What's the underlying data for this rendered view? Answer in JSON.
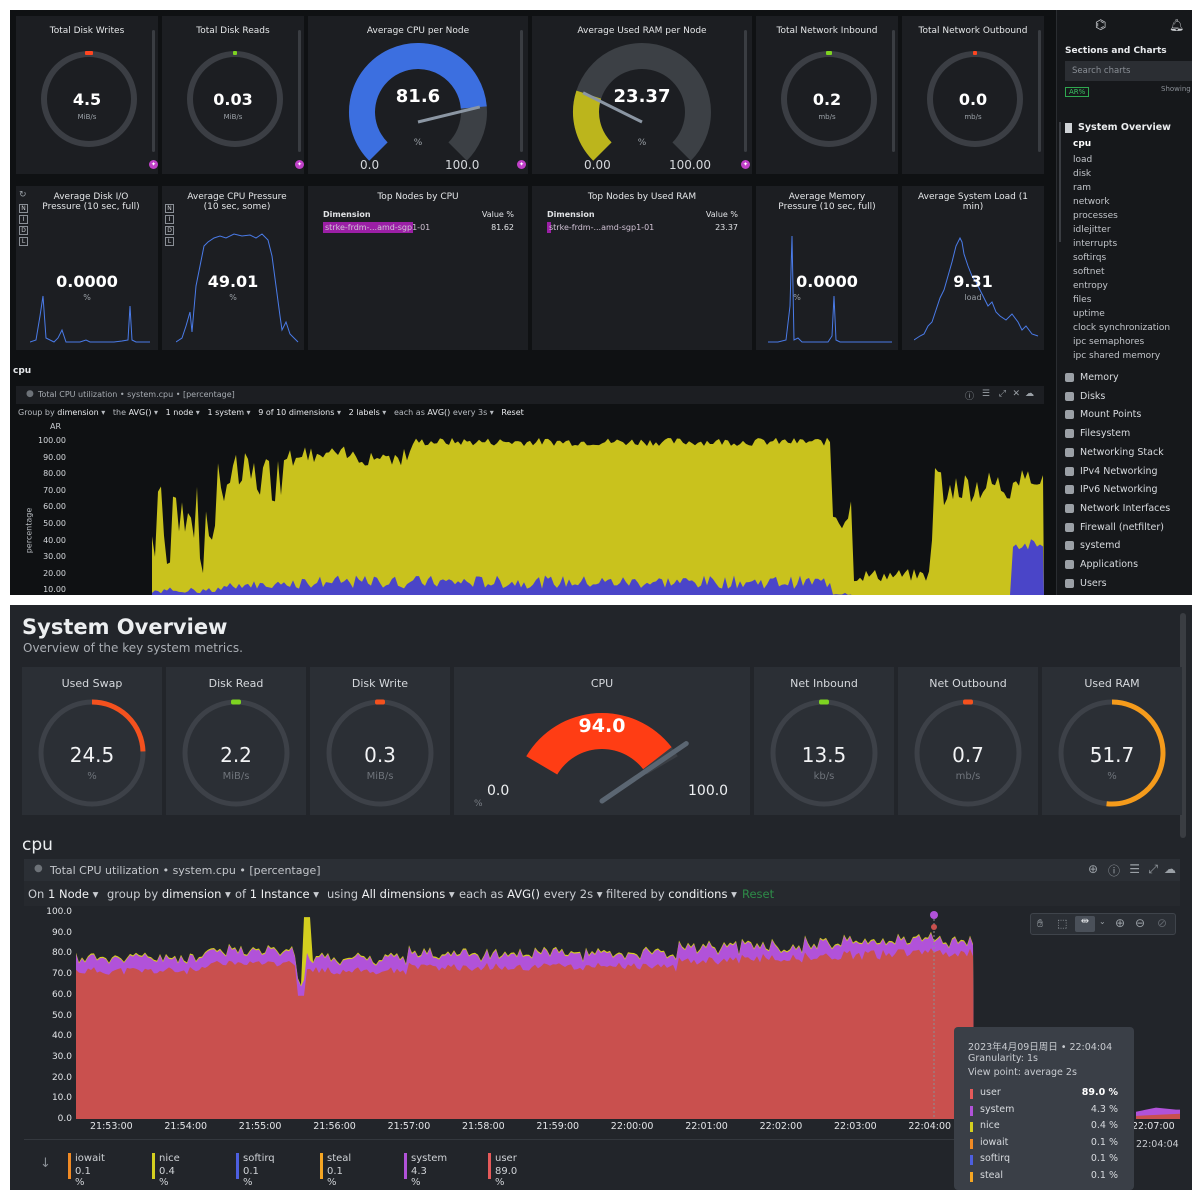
{
  "top": {
    "gauges": [
      {
        "title": "Total Disk Writes",
        "value": "4.5",
        "unit": "MiB/s",
        "marker_color": "#ff4520"
      },
      {
        "title": "Total Disk Reads",
        "value": "0.03",
        "unit": "MiB/s",
        "marker_color": "#7ed321"
      }
    ],
    "gauges_right": [
      {
        "title": "Total Network Inbound",
        "value": "0.2",
        "unit": "mb/s",
        "marker_color": "#7ed321"
      },
      {
        "title": "Total Network Outbound",
        "value": "0.0",
        "unit": "mb/s",
        "marker_color": "#ff4520"
      }
    ],
    "big_gauges": [
      {
        "title": "Average CPU per Node",
        "value": "81.6",
        "unit": "%",
        "min": "0.0",
        "max": "100.0",
        "fraction": 0.816,
        "color": "#3c6fe0"
      },
      {
        "title": "Average Used RAM per Node",
        "value": "23.37",
        "unit": "%",
        "min": "0.00",
        "max": "100.00",
        "fraction": 0.2337,
        "color": "#bcb51c"
      }
    ],
    "sparks": [
      {
        "title": "Average Disk I/O Pressure (10 sec, full)",
        "value": "0.0000",
        "unit": "%"
      },
      {
        "title": "Average CPU Pressure (10 sec, some)",
        "value": "49.01",
        "unit": "%"
      },
      {
        "title": "Average Memory Pressure (10 sec, full)",
        "value": "0.0000",
        "unit": "%"
      },
      {
        "title": "Average System Load (1 min)",
        "value": "9.31",
        "unit": "load"
      }
    ],
    "side_letters": [
      "N",
      "I",
      "D",
      "L"
    ],
    "top_nodes": [
      {
        "title": "Top Nodes by CPU",
        "col1": "Dimension",
        "col2": "Value %",
        "name": "strke-frdm-...amd-sgp1-01",
        "value": "81.62",
        "bar_fraction": 0.82
      },
      {
        "title": "Top Nodes by Used RAM",
        "col1": "Dimension",
        "col2": "Value %",
        "name": "strke-frdm-...amd-sgp1-01",
        "value": "23.37",
        "bar_fraction": 0.03
      }
    ],
    "section_label": "cpu",
    "chart_header": "Total CPU utilization • system.cpu • [percentage]",
    "chart_controls": {
      "group_by": "Group by",
      "group_by_val": "dimension",
      "the": "the",
      "the_val": "AVG()",
      "node": "1 node",
      "system": "1 system",
      "dims": "9 of 10 dimensions",
      "labels": "2 labels",
      "each_as": "each as",
      "each_as_val": "AVG()",
      "every": "every 3s",
      "reset": "Reset"
    },
    "chart_ylabel": "percentage",
    "chart_ar": "AR",
    "chart_yticks": [
      "100.00",
      "90.00",
      "80.00",
      "70.00",
      "60.00",
      "50.00",
      "40.00",
      "30.00",
      "20.00",
      "10.00"
    ],
    "sidebar": {
      "title": "Sections and Charts",
      "search_placeholder": "Search charts",
      "ar_badge": "AR%",
      "showing": "Showing",
      "active_section": "System Overview",
      "active_item": "cpu",
      "items": [
        "load",
        "disk",
        "ram",
        "network",
        "processes",
        "idlejitter",
        "interrupts",
        "softirqs",
        "softnet",
        "entropy",
        "files",
        "uptime",
        "clock synchronization",
        "ipc semaphores",
        "ipc shared memory"
      ],
      "groups": [
        "Memory",
        "Disks",
        "Mount Points",
        "Filesystem",
        "Networking Stack",
        "IPv4 Networking",
        "IPv6 Networking",
        "Network Interfaces",
        "Firewall (netfilter)",
        "systemd",
        "Applications",
        "Users"
      ]
    }
  },
  "bottom": {
    "title": "System Overview",
    "subtitle": "Overview of the key system metrics.",
    "gauges_left": [
      {
        "title": "Used Swap",
        "value": "24.5",
        "unit": "%",
        "fraction": 0.245,
        "color": "#f4511e"
      },
      {
        "title": "Disk Read",
        "value": "2.2",
        "unit": "MiB/s",
        "fraction": 0,
        "color": "#7ed321"
      },
      {
        "title": "Disk Write",
        "value": "0.3",
        "unit": "MiB/s",
        "fraction": 0,
        "color": "#f4511e"
      }
    ],
    "cpu_gauge": {
      "title": "CPU",
      "value": "94.0",
      "unit": "%",
      "min": "0.0",
      "max": "100.0",
      "fraction": 0.94,
      "color": "#ff3d14"
    },
    "gauges_right": [
      {
        "title": "Net Inbound",
        "value": "13.5",
        "unit": "kb/s",
        "fraction": 0,
        "color": "#7ed321"
      },
      {
        "title": "Net Outbound",
        "value": "0.7",
        "unit": "mb/s",
        "fraction": 0,
        "color": "#f4511e"
      },
      {
        "title": "Used RAM",
        "value": "51.7",
        "unit": "%",
        "fraction": 0.517,
        "color": "#f59b1b"
      }
    ],
    "section_label": "cpu",
    "chart_header": "Total CPU utilization • system.cpu • [percentage]",
    "controls": {
      "on": "On",
      "on_val": "1 Node",
      "group": "group by",
      "group_val": "dimension",
      "of": "of",
      "of_val": "1 Instance",
      "using": "using",
      "using_val": "All dimensions",
      "each": "each as",
      "each_val": "AVG()",
      "every": "every 2s",
      "filtered": "filtered by",
      "filtered_val": "conditions",
      "reset": "Reset"
    },
    "yticks": [
      "100.0",
      "90.0",
      "80.0",
      "70.0",
      "60.0",
      "50.0",
      "40.0",
      "30.0",
      "20.0",
      "10.0",
      "0.0"
    ],
    "xticks": [
      "21:53:00",
      "21:54:00",
      "21:55:00",
      "21:56:00",
      "21:57:00",
      "21:58:00",
      "21:59:00",
      "22:00:00",
      "22:01:00",
      "22:02:00",
      "22:03:00",
      "22:04:00",
      "22:07:00"
    ],
    "x_extra": "22:04:04",
    "tooltip": {
      "date": "2023年4月09日周日 • 22:04:04",
      "granularity": "Granularity: 1s",
      "viewpoint": "View point: average 2s",
      "rows": [
        {
          "name": "user",
          "value": "89.0 %",
          "color": "#e55a5a"
        },
        {
          "name": "system",
          "value": "4.3 %",
          "color": "#b152d9"
        },
        {
          "name": "nice",
          "value": "0.4 %",
          "color": "#d4cf1f"
        },
        {
          "name": "iowait",
          "value": "0.1 %",
          "color": "#f08a24"
        },
        {
          "name": "softirq",
          "value": "0.1 %",
          "color": "#4d5fe0"
        },
        {
          "name": "steal",
          "value": "0.1 %",
          "color": "#f5a623"
        }
      ]
    },
    "legend": [
      {
        "name": "iowait",
        "value": "0.1 %",
        "color": "#f08a24"
      },
      {
        "name": "nice",
        "value": "0.4 %",
        "color": "#d4cf1f"
      },
      {
        "name": "softirq",
        "value": "0.1 %",
        "color": "#4d5fe0"
      },
      {
        "name": "steal",
        "value": "0.1 %",
        "color": "#f5a623"
      },
      {
        "name": "system",
        "value": "4.3 %",
        "color": "#b152d9"
      },
      {
        "name": "user",
        "value": "89.0 %",
        "color": "#e55a5a"
      }
    ]
  }
}
